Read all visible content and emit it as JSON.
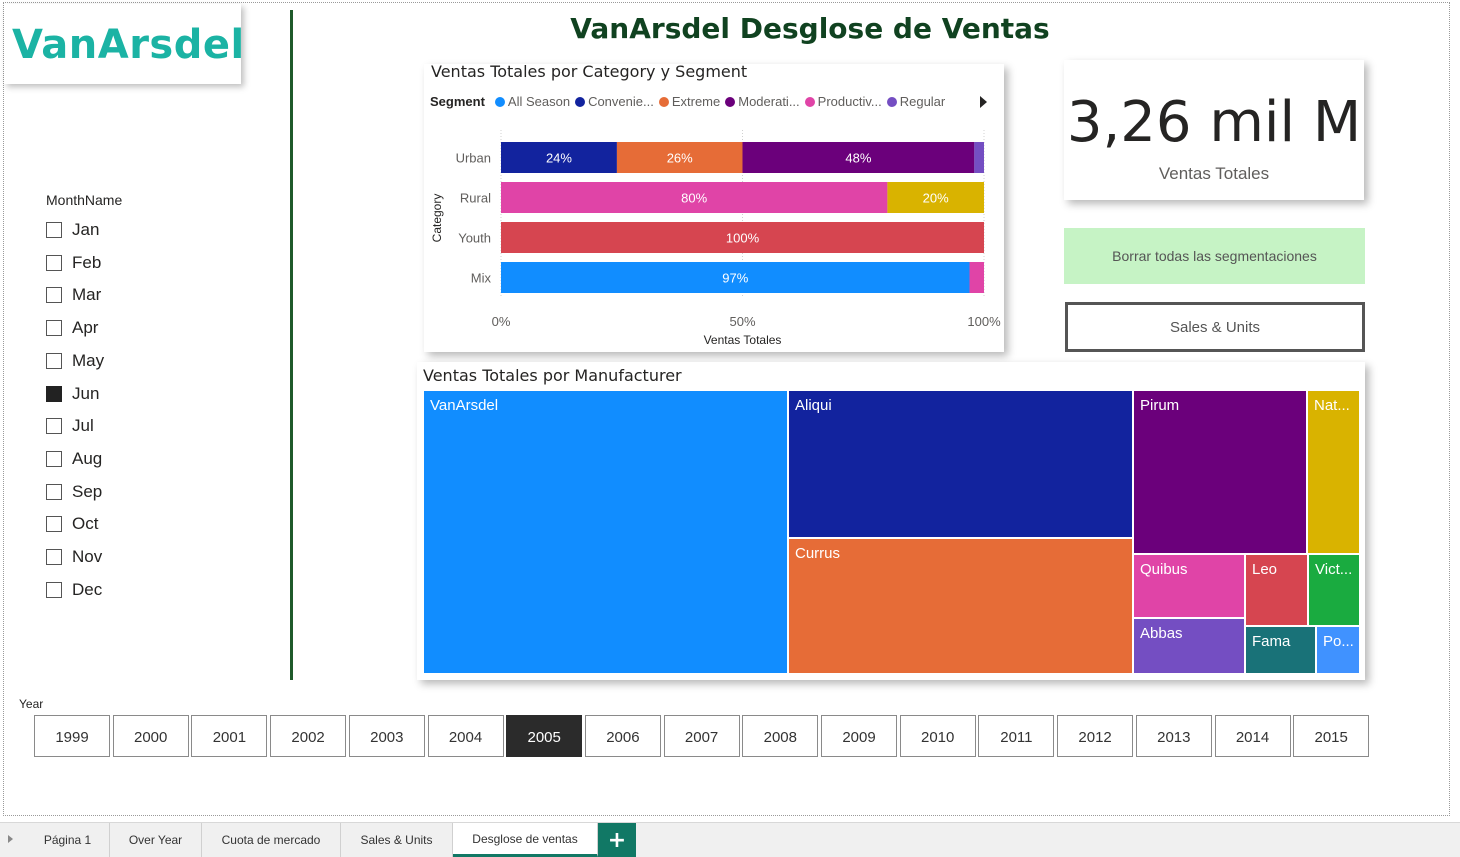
{
  "logo": {
    "text": "VanArsdel"
  },
  "page_title": "VanArsdel Desglose de Ventas",
  "month_slicer": {
    "title": "MonthName",
    "items": [
      {
        "label": "Jan",
        "checked": false
      },
      {
        "label": "Feb",
        "checked": false
      },
      {
        "label": "Mar",
        "checked": false
      },
      {
        "label": "Apr",
        "checked": false
      },
      {
        "label": "May",
        "checked": false
      },
      {
        "label": "Jun",
        "checked": true
      },
      {
        "label": "Jul",
        "checked": false
      },
      {
        "label": "Aug",
        "checked": false
      },
      {
        "label": "Sep",
        "checked": false
      },
      {
        "label": "Oct",
        "checked": false
      },
      {
        "label": "Nov",
        "checked": false
      },
      {
        "label": "Dec",
        "checked": false
      }
    ]
  },
  "bar_chart": {
    "title": "Ventas Totales por Category y Segment",
    "legend_title": "Segment",
    "legend": [
      {
        "label": "All Season",
        "color": "#118dff"
      },
      {
        "label": "Convenie...",
        "color": "#12239e"
      },
      {
        "label": "Extreme",
        "color": "#e66c37"
      },
      {
        "label": "Moderati...",
        "color": "#6b007b"
      },
      {
        "label": "Productiv...",
        "color": "#e044a7"
      },
      {
        "label": "Regular",
        "color": "#744ec2"
      }
    ]
  },
  "chart_data": [
    {
      "type": "bar",
      "orientation": "horizontal",
      "stacked": "100%",
      "title": "Ventas Totales por Category y Segment",
      "xlabel": "Ventas Totales",
      "ylabel": "Category",
      "xlim": [
        0,
        100
      ],
      "x_ticks": [
        "0%",
        "50%",
        "100%"
      ],
      "categories": [
        "Urban",
        "Rural",
        "Youth",
        "Mix"
      ],
      "rows": [
        {
          "category": "Urban",
          "segments": [
            {
              "color": "#12239e",
              "value": 24,
              "label": "24%"
            },
            {
              "color": "#e66c37",
              "value": 26,
              "label": "26%"
            },
            {
              "color": "#6b007b",
              "value": 48,
              "label": "48%"
            },
            {
              "color": "#744ec2",
              "value": 2,
              "label": ""
            }
          ]
        },
        {
          "category": "Rural",
          "segments": [
            {
              "color": "#e044a7",
              "value": 80,
              "label": "80%"
            },
            {
              "color": "#d9b300",
              "value": 20,
              "label": "20%"
            }
          ]
        },
        {
          "category": "Youth",
          "segments": [
            {
              "color": "#d64550",
              "value": 100,
              "label": "100%"
            }
          ]
        },
        {
          "category": "Mix",
          "segments": [
            {
              "color": "#118dff",
              "value": 97,
              "label": "97%"
            },
            {
              "color": "#e044a7",
              "value": 3,
              "label": ""
            }
          ]
        }
      ]
    }
  ],
  "kpi": {
    "value": "3,26 mil M",
    "label": "Ventas Totales"
  },
  "buttons": {
    "clear_label": "Borrar todas las segmentaciones",
    "nav_label": "Sales & Units"
  },
  "treemap": {
    "title": "Ventas Totales por Manufacturer",
    "items": [
      {
        "label": "VanArsdel",
        "color": "#118dff"
      },
      {
        "label": "Aliqui",
        "color": "#12239e"
      },
      {
        "label": "Currus",
        "color": "#e66c37"
      },
      {
        "label": "Pirum",
        "color": "#6b007b"
      },
      {
        "label": "Nat...",
        "color": "#d9b300"
      },
      {
        "label": "Quibus",
        "color": "#e044a7"
      },
      {
        "label": "Leo",
        "color": "#d64550"
      },
      {
        "label": "Vict...",
        "color": "#1aab40"
      },
      {
        "label": "Abbas",
        "color": "#744ec2"
      },
      {
        "label": "Fama",
        "color": "#197278"
      },
      {
        "label": "Po...",
        "color": "#4092ff"
      }
    ]
  },
  "year_slicer": {
    "title": "Year",
    "years": [
      "1999",
      "2000",
      "2001",
      "2002",
      "2003",
      "2004",
      "2005",
      "2006",
      "2007",
      "2008",
      "2009",
      "2010",
      "2011",
      "2012",
      "2013",
      "2014",
      "2015"
    ],
    "selected": "2005"
  },
  "tabs": [
    "Página 1",
    "Over Year",
    "Cuota de mercado",
    "Sales & Units",
    "Desglose de ventas"
  ],
  "active_tab": "Desglose de ventas",
  "add_tab_label": "+"
}
